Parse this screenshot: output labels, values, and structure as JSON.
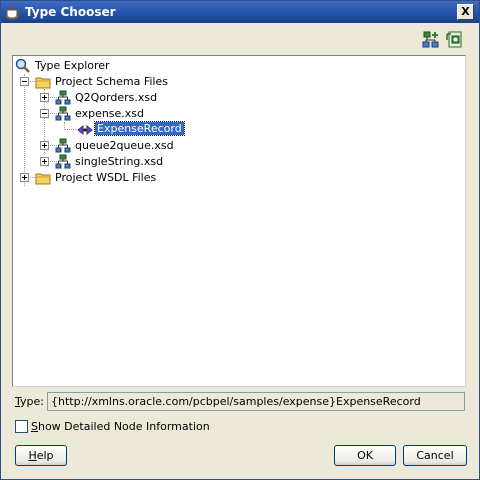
{
  "window": {
    "title": "Type Chooser",
    "close_label": "X"
  },
  "toolbar": {
    "icons": [
      "hierarchy-add-icon",
      "schema-import-icon"
    ]
  },
  "tree": {
    "root": "Type Explorer",
    "items": [
      {
        "label": "Project Schema Files"
      },
      {
        "label": "Q2Qorders.xsd"
      },
      {
        "label": "expense.xsd"
      },
      {
        "label": "ExpenseRecord"
      },
      {
        "label": "queue2queue.xsd"
      },
      {
        "label": "singleString.xsd"
      },
      {
        "label": "Project WSDL Files"
      }
    ]
  },
  "type_field": {
    "label_mnemonic": "T",
    "label_rest": "ype:",
    "value": "{http://xmlns.oracle.com/pcbpel/samples/expense}ExpenseRecord"
  },
  "options": {
    "show_detail_mnemonic": "S",
    "show_detail_rest": "how Detailed Node Information",
    "checked": false
  },
  "buttons": {
    "help_mnemonic": "H",
    "help_rest": "elp",
    "ok": "OK",
    "cancel": "Cancel"
  }
}
